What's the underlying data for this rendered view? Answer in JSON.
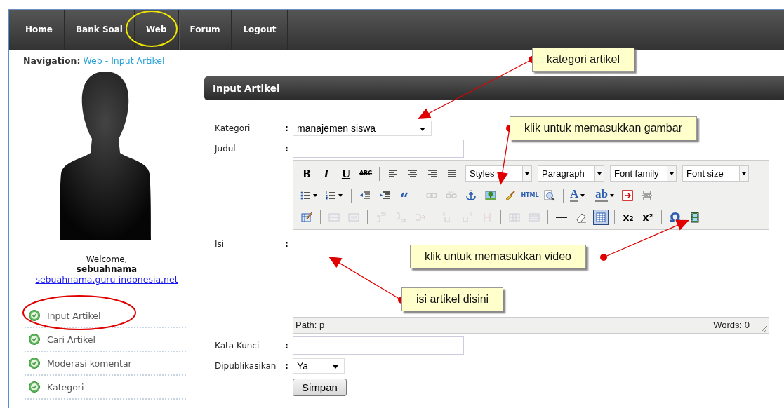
{
  "nav": {
    "items": [
      {
        "label": "Home"
      },
      {
        "label": "Bank Soal"
      },
      {
        "label": "Web"
      },
      {
        "label": "Forum"
      },
      {
        "label": "Logout"
      }
    ]
  },
  "breadcrumb": {
    "label": "Navigation:",
    "path": "Web - Input Artikel"
  },
  "sidebar": {
    "welcome": "Welcome,",
    "username": "sebuahnama",
    "site_link": "sebuahnama.guru-indonesia.net",
    "menu": [
      {
        "label": "Input Artikel"
      },
      {
        "label": "Cari Artikel"
      },
      {
        "label": "Moderasi komentar"
      },
      {
        "label": "Kategori"
      }
    ]
  },
  "panel": {
    "title": "Input Artikel",
    "fields": [
      {
        "kind": "select",
        "label": "Kategori",
        "colon": ":",
        "value": "manajemen siswa"
      },
      {
        "kind": "text",
        "label": "Judul",
        "colon": ":"
      },
      {
        "kind": "editor",
        "label": "Isi",
        "colon": ":"
      },
      {
        "kind": "text",
        "label": "Kata Kunci",
        "colon": ":"
      },
      {
        "kind": "select",
        "label": "Dipublikasikan",
        "colon": ":",
        "value": "Ya"
      }
    ],
    "editor": {
      "toolbar": [
        [
          {
            "kind": "glyph",
            "text": "B",
            "disabled": false,
            "selected": false
          },
          {
            "kind": "glyph",
            "text": "I",
            "disabled": false,
            "selected": false
          },
          {
            "kind": "glyph",
            "text": "U",
            "disabled": false,
            "selected": false
          },
          {
            "kind": "glyph",
            "text": "ABC",
            "disabled": false,
            "selected": false
          },
          {
            "kind": "separator"
          },
          {
            "kind": "icon",
            "disabled": false,
            "selected": false
          },
          {
            "kind": "icon",
            "disabled": false,
            "selected": false
          },
          {
            "kind": "icon",
            "disabled": false,
            "selected": false
          },
          {
            "kind": "icon",
            "disabled": false,
            "selected": false
          },
          {
            "kind": "select",
            "label": "Styles"
          },
          {
            "kind": "select",
            "label": "Paragraph"
          },
          {
            "kind": "select",
            "label": "Font family"
          },
          {
            "kind": "select",
            "label": "Font size"
          }
        ],
        [
          {
            "kind": "split",
            "disabled": false,
            "selected": false
          },
          {
            "kind": "split",
            "disabled": false,
            "selected": false
          },
          {
            "kind": "separator"
          },
          {
            "kind": "icon",
            "disabled": false,
            "selected": false
          },
          {
            "kind": "icon",
            "disabled": false,
            "selected": false
          },
          {
            "kind": "glyph",
            "text": "“",
            "disabled": false,
            "selected": false
          },
          {
            "kind": "separator"
          },
          {
            "kind": "icon",
            "disabled": true,
            "selected": false
          },
          {
            "kind": "icon",
            "disabled": true,
            "selected": false
          },
          {
            "kind": "icon",
            "disabled": false,
            "selected": false
          },
          {
            "kind": "icon",
            "disabled": false,
            "selected": false
          },
          {
            "kind": "icon",
            "disabled": false,
            "selected": false
          },
          {
            "kind": "glyph",
            "text": "HTML",
            "disabled": false,
            "selected": false
          },
          {
            "kind": "icon",
            "disabled": false,
            "selected": false
          },
          {
            "kind": "separator"
          },
          {
            "kind": "color-split",
            "text": "A",
            "disabled": false,
            "selected": false
          },
          {
            "kind": "color-split",
            "text": "ab",
            "disabled": false,
            "selected": false
          },
          {
            "kind": "icon",
            "disabled": false,
            "selected": false
          },
          {
            "kind": "icon",
            "disabled": false,
            "selected": false
          }
        ],
        [
          {
            "kind": "icon",
            "disabled": false,
            "selected": false
          },
          {
            "kind": "separator"
          },
          {
            "kind": "icon",
            "disabled": true,
            "selected": false
          },
          {
            "kind": "icon",
            "disabled": true,
            "selected": false
          },
          {
            "kind": "separator"
          },
          {
            "kind": "icon",
            "disabled": true,
            "selected": false
          },
          {
            "kind": "icon",
            "disabled": true,
            "selected": false
          },
          {
            "kind": "icon",
            "disabled": true,
            "selected": false
          },
          {
            "kind": "separator"
          },
          {
            "kind": "icon",
            "disabled": true,
            "selected": false
          },
          {
            "kind": "icon",
            "disabled": true,
            "selected": false
          },
          {
            "kind": "icon",
            "disabled": true,
            "selected": false
          },
          {
            "kind": "separator"
          },
          {
            "kind": "icon",
            "disabled": true,
            "selected": false
          },
          {
            "kind": "icon",
            "disabled": true,
            "selected": false
          },
          {
            "kind": "separator"
          },
          {
            "kind": "icon",
            "disabled": false,
            "selected": false
          },
          {
            "kind": "icon",
            "disabled": false,
            "selected": false
          },
          {
            "kind": "icon",
            "disabled": false,
            "selected": true
          },
          {
            "kind": "separator"
          },
          {
            "kind": "glyph",
            "text": "x₂",
            "disabled": false,
            "selected": false
          },
          {
            "kind": "glyph",
            "text": "x²",
            "disabled": false,
            "selected": false
          },
          {
            "kind": "separator"
          },
          {
            "kind": "glyph",
            "text": "Ω",
            "disabled": false,
            "selected": false
          },
          {
            "kind": "icon",
            "disabled": false,
            "selected": false
          }
        ]
      ],
      "path": "Path: p",
      "words": "Words: 0"
    },
    "submit": "Simpan"
  },
  "annotations": [
    {
      "text": "kategori artikel"
    },
    {
      "text": "klik untuk memasukkan gambar"
    },
    {
      "text": "klik untuk memasukkan video"
    },
    {
      "text": "isi artikel disini"
    }
  ]
}
